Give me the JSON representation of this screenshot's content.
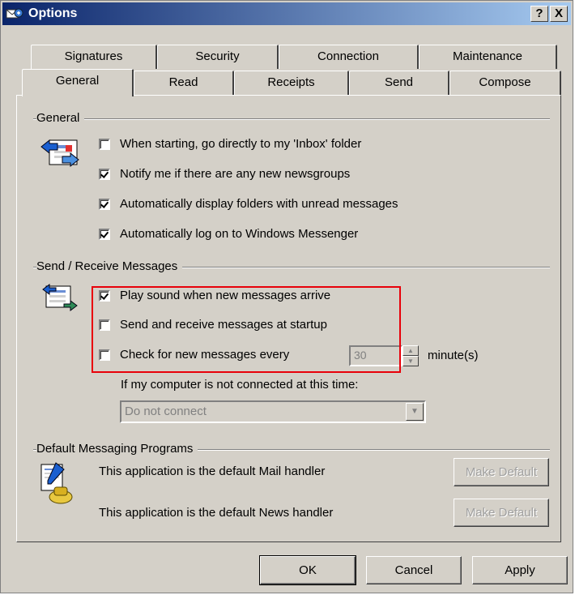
{
  "window": {
    "title": "Options",
    "help_button": "?",
    "close_button": "X"
  },
  "tabs_back": [
    "Signatures",
    "Security",
    "Connection",
    "Maintenance"
  ],
  "tabs_front": [
    "General",
    "Read",
    "Receipts",
    "Send",
    "Compose"
  ],
  "selected_tab": "General",
  "general": {
    "title": "General",
    "options": [
      {
        "label": "When starting, go directly to my 'Inbox' folder",
        "checked": false
      },
      {
        "label": "Notify me if there are any new newsgroups",
        "checked": true
      },
      {
        "label": "Automatically display folders with unread messages",
        "checked": true
      },
      {
        "label": "Automatically log on to Windows Messenger",
        "checked": true
      }
    ]
  },
  "send_receive": {
    "title": "Send / Receive Messages",
    "play_sound": {
      "label": "Play sound when new messages arrive",
      "checked": true
    },
    "send_receive_startup": {
      "label": "Send and receive messages at startup",
      "checked": false
    },
    "check_every": {
      "label": "Check for new messages every",
      "checked": false,
      "value": "30",
      "unit": "minute(s)"
    },
    "not_connected_label": "If my computer is not connected at this time:",
    "connect_option": "Do not connect"
  },
  "default_programs": {
    "title": "Default Messaging Programs",
    "mail_text": "This application is the default Mail handler",
    "news_text": "This application is the default News handler",
    "make_default_label": "Make Default"
  },
  "buttons": {
    "ok": "OK",
    "cancel": "Cancel",
    "apply": "Apply"
  },
  "colors": {
    "titlebar_start": "#0a246a",
    "titlebar_end": "#a6caf0",
    "face": "#d4d0c8",
    "highlight_box": "#e8000a"
  }
}
